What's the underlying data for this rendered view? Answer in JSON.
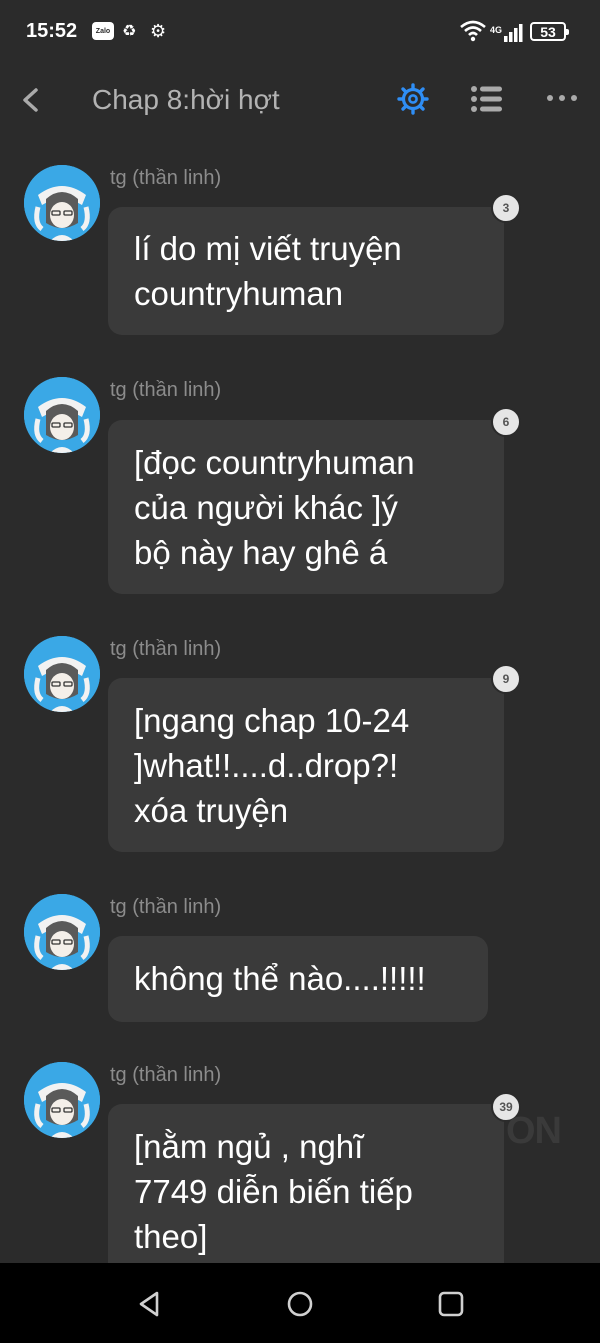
{
  "status_bar": {
    "time": "15:52",
    "zalo_label": "Zalo",
    "network": "4G",
    "battery": "53",
    "icons": [
      "zalo-icon",
      "recycle-icon",
      "settings-icon",
      "wifi-icon",
      "signal-icon",
      "battery-icon"
    ]
  },
  "header": {
    "title": "Chap 8:hời hợt",
    "icons": [
      "back-icon",
      "gear-icon",
      "list-icon",
      "more-icon"
    ],
    "accent_color": "#2f8ef5"
  },
  "messages": [
    {
      "sender": "tg (thần linh)",
      "text": "lí do mị viết truyện\ncountryhuman",
      "count": "3"
    },
    {
      "sender": "tg (thần linh)",
      "text": "[đọc countryhuman\ncủa người khác ]ý\nbộ này hay ghê á",
      "count": "6"
    },
    {
      "sender": "tg (thần linh)",
      "text": "[ngang chap 10-24\n]what!!....d..drop?!\nxóa truyện",
      "count": "9"
    },
    {
      "sender": "tg (thần linh)",
      "text": "không thể nào....!!!!!",
      "count": ""
    },
    {
      "sender": "tg (thần linh)",
      "text": "[nằm ngủ , nghĩ\n7749 diễn biến tiếp\ntheo]",
      "count": "39"
    }
  ],
  "watermark": "ON",
  "nav": {
    "icons": [
      "back-triangle-icon",
      "home-circle-icon",
      "recents-square-icon"
    ]
  }
}
